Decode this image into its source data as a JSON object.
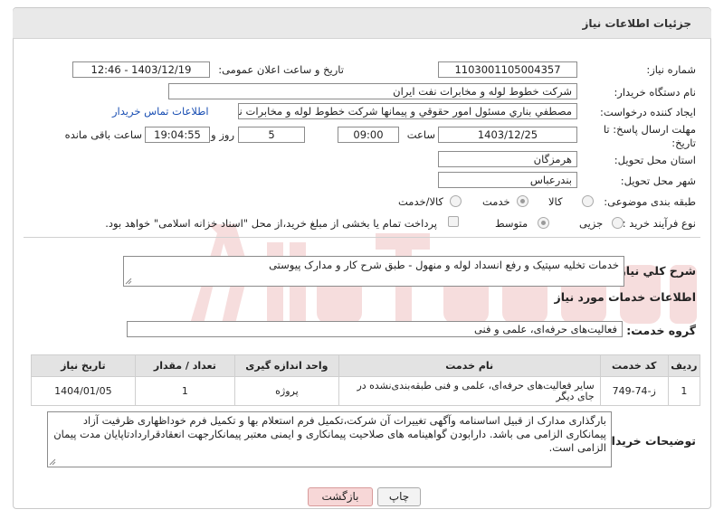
{
  "header": {
    "title": "جزئیات اطلاعات نیاز"
  },
  "form": {
    "need_number": {
      "label": "شماره نیاز:",
      "value": "1103001105004357"
    },
    "announce_datetime": {
      "label": "تاریخ و ساعت اعلان عمومی:",
      "value": "1403/12/19 - 12:46"
    },
    "buyer_org": {
      "label": "نام دستگاه خریدار:",
      "value": "شرکت خطوط لوله و مخابرات نفت ایران"
    },
    "requester": {
      "label": "ایجاد کننده درخواست:",
      "value": "مصطفي بناري مسئول امور حقوقي و پيمانها  شركت خطوط لوله و مخابرات نفت",
      "contact_link": "اطلاعات تماس خریدار"
    },
    "deadline": {
      "label_line1": "مهلت ارسال پاسخ: تا",
      "label_line2": "تاریخ:",
      "date": "1403/12/25",
      "time_label": "ساعت",
      "time": "09:00",
      "days": "5",
      "days_label": "روز و",
      "remaining": "19:04:55",
      "remaining_label": "ساعت باقی مانده"
    },
    "province": {
      "label": "استان محل تحویل:",
      "value": "هرمزگان"
    },
    "city": {
      "label": "شهر محل تحویل:",
      "value": "بندرعباس"
    },
    "category": {
      "label": "طبقه بندی موضوعی:",
      "options": [
        "کالا",
        "خدمت",
        "کالا/خدمت"
      ],
      "selected": "خدمت"
    },
    "purchase_type": {
      "label": "نوع فرآیند خرید :",
      "options": [
        "جزیی",
        "متوسط"
      ],
      "selected": "متوسط",
      "treasury_note": "پرداخت تمام یا بخشی از مبلغ خرید،از محل \"اسناد خزانه اسلامی\" خواهد بود."
    }
  },
  "summary": {
    "label": "شرح کلي نياز:",
    "value": "خدمات تخليه سپتيک و رفع انسداد لوله و منهول - طبق شرح کار و مدارک پيوستی"
  },
  "services_section": {
    "title": "اطلاعات خدمات مورد نیاز"
  },
  "service_group": {
    "label": "گروه خدمت:",
    "value": "فعالیت‌های حرفه‌ای، علمی و فنی"
  },
  "table": {
    "headers": [
      "ردیف",
      "کد خدمت",
      "نام خدمت",
      "واحد اندازه گیری",
      "تعداد / مقدار",
      "تاریخ نیاز"
    ],
    "rows": [
      {
        "row": "1",
        "code": "ز-74-749",
        "name": "سایر فعالیت‌های حرفه‌ای، علمی و فنی طبقه‌بندی‌نشده در جای دیگر",
        "unit": "پروژه",
        "qty": "1",
        "date": "1404/01/05"
      }
    ]
  },
  "buyer_notes": {
    "label": "توضیحات خریدار:",
    "value": "بارگذاری مدارک از قبیل اساسنامه وآگهی تغییرات  آن شرکت،تکمیل فرم استعلام بها و تکمیل فرم خوداظهاری ظرفیت آزاد پیمانکاری الزامی می باشد. دارابودن گواهینامه های صلاحیت پیمانکاری و ایمنی معتبر پیمانکارجهت انعقادقراردادتاپایان مدت پیمان الزامی است."
  },
  "buttons": {
    "print": "چاپ",
    "back": "بازگشت"
  },
  "colors": {
    "link": "#1a4fb3",
    "back_button": "#f7d7d7",
    "header_bg": "#e9e9e9",
    "table_header_bg": "#e3e3e3"
  }
}
